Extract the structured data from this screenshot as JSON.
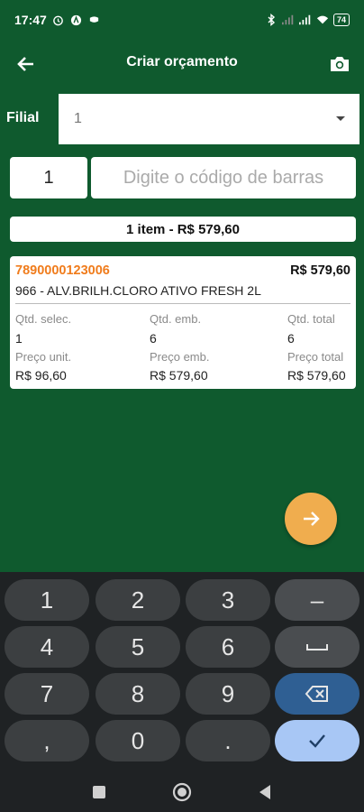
{
  "status_bar": {
    "time": "17:47",
    "battery": "74",
    "network": "5G"
  },
  "app_bar": {
    "title": "Criar orçamento",
    "icons": [
      "arrow-left-icon",
      "camera-icon"
    ]
  },
  "filial": {
    "label": "Filial",
    "value": "1"
  },
  "entry": {
    "quantity": "1",
    "barcode_placeholder": "Digite o código de barras"
  },
  "summary": {
    "text": "1 item - R$ 579,60"
  },
  "item": {
    "barcode": "7890000123006",
    "price_total": "R$ 579,60",
    "description": "966 - ALV.BRILH.CLORO ATIVO FRESH 2L",
    "fields": {
      "qtd_selec_label": "Qtd. selec.",
      "qtd_selec_value": "1",
      "qtd_emb_label": "Qtd. emb.",
      "qtd_emb_value": "6",
      "qtd_total_label": "Qtd. total",
      "qtd_total_value": "6",
      "preco_unit_label": "Preço unit.",
      "preco_unit_value": "R$ 96,60",
      "preco_emb_label": "Preço emb.",
      "preco_emb_value": "R$ 579,60",
      "preco_total_label": "Preço total",
      "preco_total_value": "R$ 579,60"
    }
  },
  "fab": {
    "icon": "arrow-right-icon",
    "color": "#f0ad4e"
  },
  "keyboard": {
    "keys": [
      "1",
      "2",
      "3",
      "–",
      "4",
      "5",
      "6",
      "␣",
      "7",
      "8",
      "9",
      "⌫",
      ",",
      "0",
      ".",
      "✓"
    ]
  },
  "colors": {
    "background": "#0f5a2e",
    "accent_orange": "#f07c1c",
    "keyboard_bg": "#1f2224",
    "delete_key": "#2f5f93",
    "enter_key": "#a8c7f5"
  }
}
